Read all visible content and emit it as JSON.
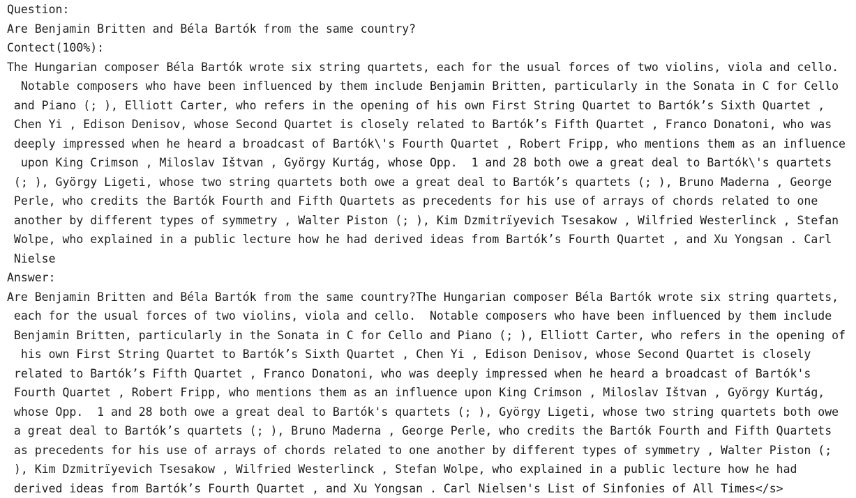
{
  "lines": [
    "Question:",
    "Are Benjamin Britten and Béla Bartók from the same country?",
    "Contect(100%):",
    "The Hungarian composer Béla Bartók wrote six string quartets, each for the usual forces of two violins, viola and cello.",
    "  Notable composers who have been influenced by them include Benjamin Britten, particularly in the Sonata in C for Cello",
    " and Piano (; ), Elliott Carter, who refers in the opening of his own First String Quartet to Bartók’s Sixth Quartet ,",
    " Chen Yi , Edison Denisov, whose Second Quartet is closely related to Bartók’s Fifth Quartet , Franco Donatoni, who was",
    " deeply impressed when he heard a broadcast of Bartók\\'s Fourth Quartet , Robert Fripp, who mentions them as an influence",
    "  upon King Crimson , Miloslav Ištvan , György Kurtág, whose Opp.  1 and 28 both owe a great deal to Bartók\\'s quartets",
    " (; ), György Ligeti, whose two string quartets both owe a great deal to Bartók’s quartets (; ), Bruno Maderna , George",
    " Perle, who credits the Bartók Fourth and Fifth Quartets as precedents for his use of arrays of chords related to one",
    " another by different types of symmetry , Walter Piston (; ), Kim Dzmitrïyevich Tsesakow , Wilfried Westerlinck , Stefan",
    " Wolpe, who explained in a public lecture how he had derived ideas from Bartók’s Fourth Quartet , and Xu Yongsan . Carl",
    " Nielse",
    "Answer:",
    "Are Benjamin Britten and Béla Bartók from the same country?The Hungarian composer Béla Bartók wrote six string quartets,",
    " each for the usual forces of two violins, viola and cello.  Notable composers who have been influenced by them include",
    " Benjamin Britten, particularly in the Sonata in C for Cello and Piano (; ), Elliott Carter, who refers in the opening of",
    "  his own First String Quartet to Bartók’s Sixth Quartet , Chen Yi , Edison Denisov, whose Second Quartet is closely",
    " related to Bartók’s Fifth Quartet , Franco Donatoni, who was deeply impressed when he heard a broadcast of Bartók's",
    " Fourth Quartet , Robert Fripp, who mentions them as an influence upon King Crimson , Miloslav Ištvan , György Kurtág,",
    " whose Opp.  1 and 28 both owe a great deal to Bartók's quartets (; ), György Ligeti, whose two string quartets both owe",
    " a great deal to Bartók’s quartets (; ), Bruno Maderna , George Perle, who credits the Bartók Fourth and Fifth Quartets",
    " as precedents for his use of arrays of chords related to one another by different types of symmetry , Walter Piston (;",
    " ), Kim Dzmitrïyevich Tsesakow , Wilfried Westerlinck , Stefan Wolpe, who explained in a public lecture how he had",
    " derived ideas from Bartók’s Fourth Quartet , and Xu Yongsan . Carl Nielsen's List of Sinfonies of All Times</s>"
  ]
}
